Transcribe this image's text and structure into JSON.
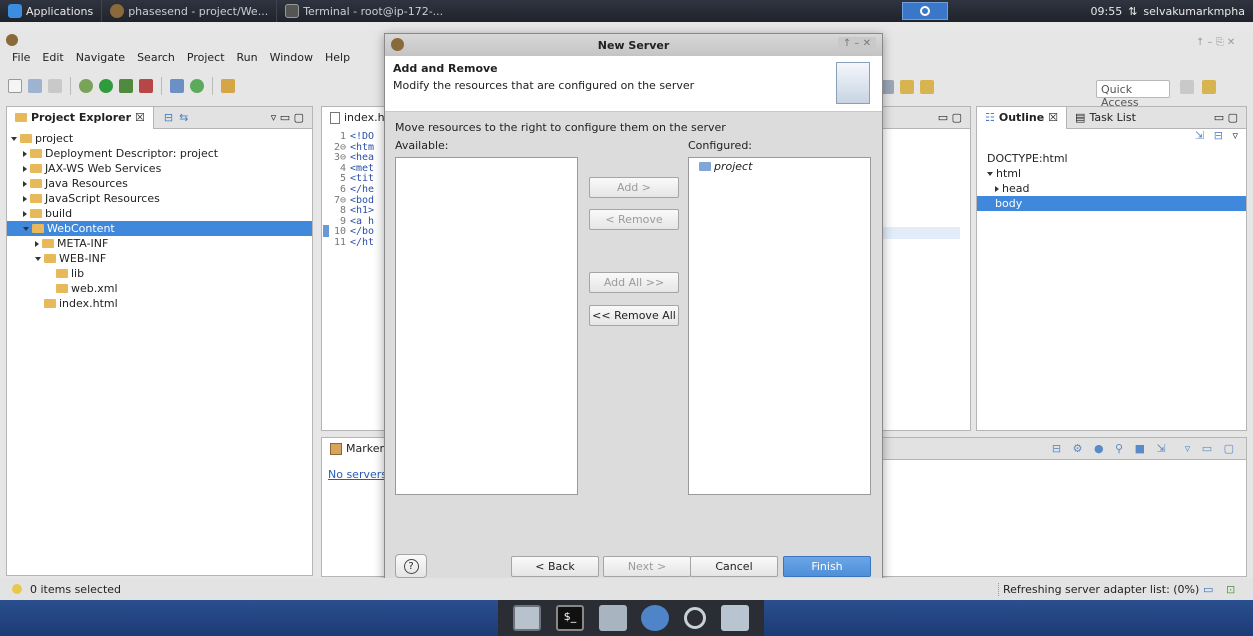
{
  "os_panel": {
    "applications": "Applications",
    "task1": "phasesend - project/We...",
    "task2": "Terminal - root@ip-172-...",
    "clock": "09:55",
    "user": "selvakumarkmpha"
  },
  "menu": [
    "File",
    "Edit",
    "Navigate",
    "Search",
    "Project",
    "Run",
    "Window",
    "Help"
  ],
  "quick_access": "Quick Access",
  "project_explorer": {
    "tab_label": "Project Explorer",
    "tab_mark": "☒",
    "tree": [
      {
        "label": "project",
        "indent": 0,
        "expanded": true
      },
      {
        "label": "Deployment Descriptor: project",
        "indent": 1,
        "expanded": false
      },
      {
        "label": "JAX-WS Web Services",
        "indent": 1,
        "expanded": false
      },
      {
        "label": "Java Resources",
        "indent": 1,
        "expanded": false
      },
      {
        "label": "JavaScript Resources",
        "indent": 1,
        "expanded": false
      },
      {
        "label": "build",
        "indent": 1,
        "expanded": false
      },
      {
        "label": "WebContent",
        "indent": 1,
        "expanded": true,
        "selected": true
      },
      {
        "label": "META-INF",
        "indent": 2,
        "expanded": false
      },
      {
        "label": "WEB-INF",
        "indent": 2,
        "expanded": true
      },
      {
        "label": "lib",
        "indent": 3
      },
      {
        "label": "web.xml",
        "indent": 3
      },
      {
        "label": "index.html",
        "indent": 2
      }
    ]
  },
  "editor": {
    "tab_label": "index.ht",
    "lines": [
      {
        "num": "1",
        "code": "<!DO"
      },
      {
        "num": "2⊖",
        "code": "<htm"
      },
      {
        "num": "3⊖",
        "code": "<hea"
      },
      {
        "num": "4",
        "code": "<met"
      },
      {
        "num": "5",
        "code": "<tit"
      },
      {
        "num": "6",
        "code": "</he"
      },
      {
        "num": "7⊖",
        "code": "<bod"
      },
      {
        "num": "8",
        "code": "<h1>"
      },
      {
        "num": "9",
        "code": "<a h"
      },
      {
        "num": "10",
        "code": "</bo"
      },
      {
        "num": "11",
        "code": "</ht"
      }
    ]
  },
  "markers": {
    "tab_label": "Markers",
    "link": "No servers"
  },
  "outline": {
    "tab_label": "Outline",
    "tab_mark": "☒",
    "task_list": "Task List",
    "tree": [
      {
        "label": "DOCTYPE:html",
        "indent": 0
      },
      {
        "label": "html",
        "indent": 0,
        "expanded": true
      },
      {
        "label": "head",
        "indent": 1,
        "expanded": false
      },
      {
        "label": "body",
        "indent": 1,
        "selected": true
      }
    ]
  },
  "dialog": {
    "title": "New Server",
    "header_title": "Add and Remove",
    "header_desc": "Modify the resources that are configured on the server",
    "instruction": "Move resources to the right to configure them on the server",
    "available_label": "Available:",
    "configured_label": "Configured:",
    "configured_items": [
      "project"
    ],
    "btn_add": "Add >",
    "btn_remove": "< Remove",
    "btn_add_all": "Add All >>",
    "btn_remove_all": "<< Remove All",
    "btn_help": "?",
    "btn_back": "< Back",
    "btn_next": "Next >",
    "btn_cancel": "Cancel",
    "btn_finish": "Finish"
  },
  "status": {
    "left": "0 items selected",
    "right": "Refreshing server adapter list: (0%)"
  },
  "colors": {
    "selection": "#3f88dc",
    "finish_button": "#5b9be0",
    "os_panel": "#24282f",
    "dock_bg": "#1e3e78"
  }
}
